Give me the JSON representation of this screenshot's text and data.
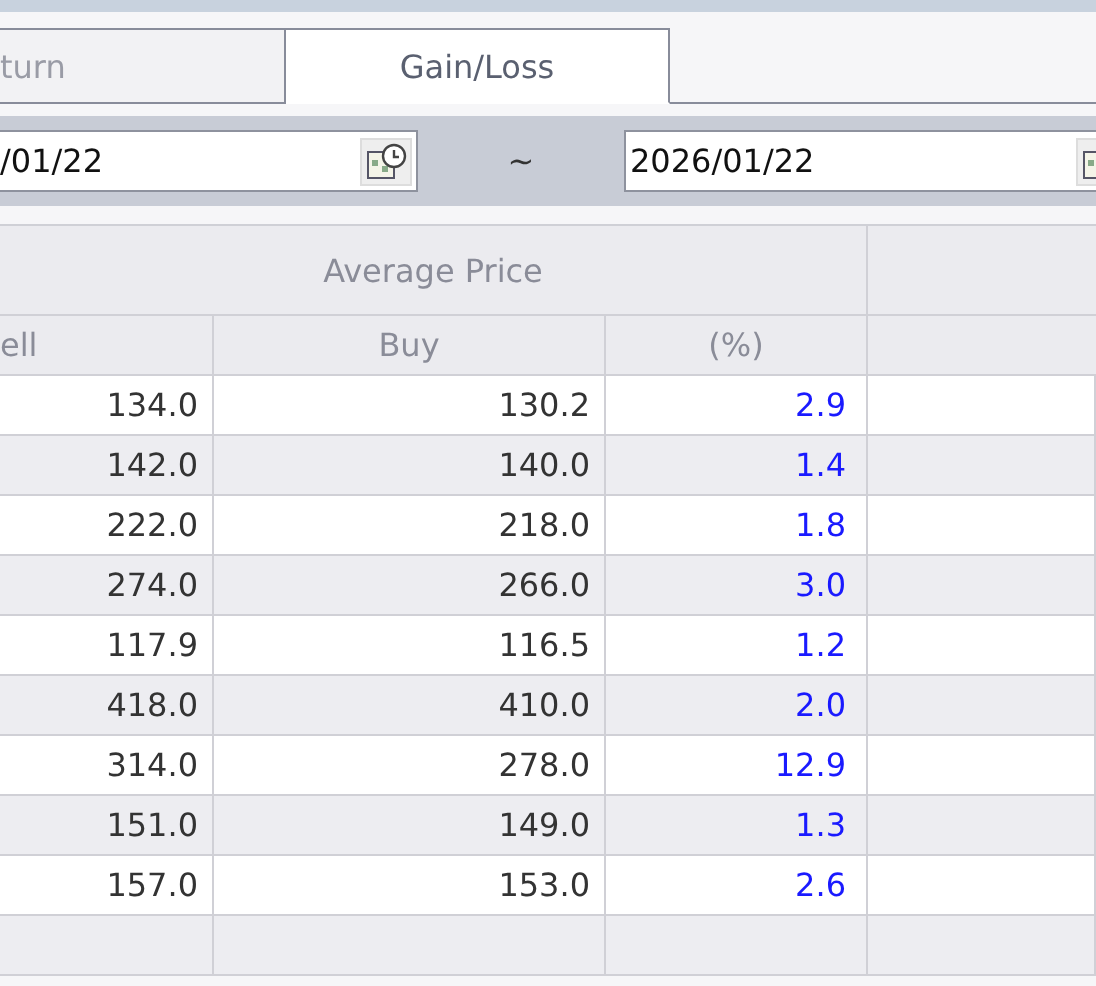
{
  "tabs": [
    {
      "label": "turn",
      "selected": false
    },
    {
      "label": "Gain/Loss",
      "selected": true
    }
  ],
  "date_range": {
    "start": "/01/22",
    "separator": "~",
    "end": "2026/01/22"
  },
  "table": {
    "group_header": "Average Price",
    "columns": [
      "ell",
      "Buy",
      "(%)"
    ],
    "rows": [
      {
        "sell": "134.0",
        "buy": "130.2",
        "pct": "2.9"
      },
      {
        "sell": "142.0",
        "buy": "140.0",
        "pct": "1.4"
      },
      {
        "sell": "222.0",
        "buy": "218.0",
        "pct": "1.8"
      },
      {
        "sell": "274.0",
        "buy": "266.0",
        "pct": "3.0"
      },
      {
        "sell": "117.9",
        "buy": "116.5",
        "pct": "1.2"
      },
      {
        "sell": "418.0",
        "buy": "410.0",
        "pct": "2.0"
      },
      {
        "sell": "314.0",
        "buy": "278.0",
        "pct": "12.9"
      },
      {
        "sell": "151.0",
        "buy": "149.0",
        "pct": "1.3"
      },
      {
        "sell": "157.0",
        "buy": "153.0",
        "pct": "2.6"
      }
    ]
  }
}
